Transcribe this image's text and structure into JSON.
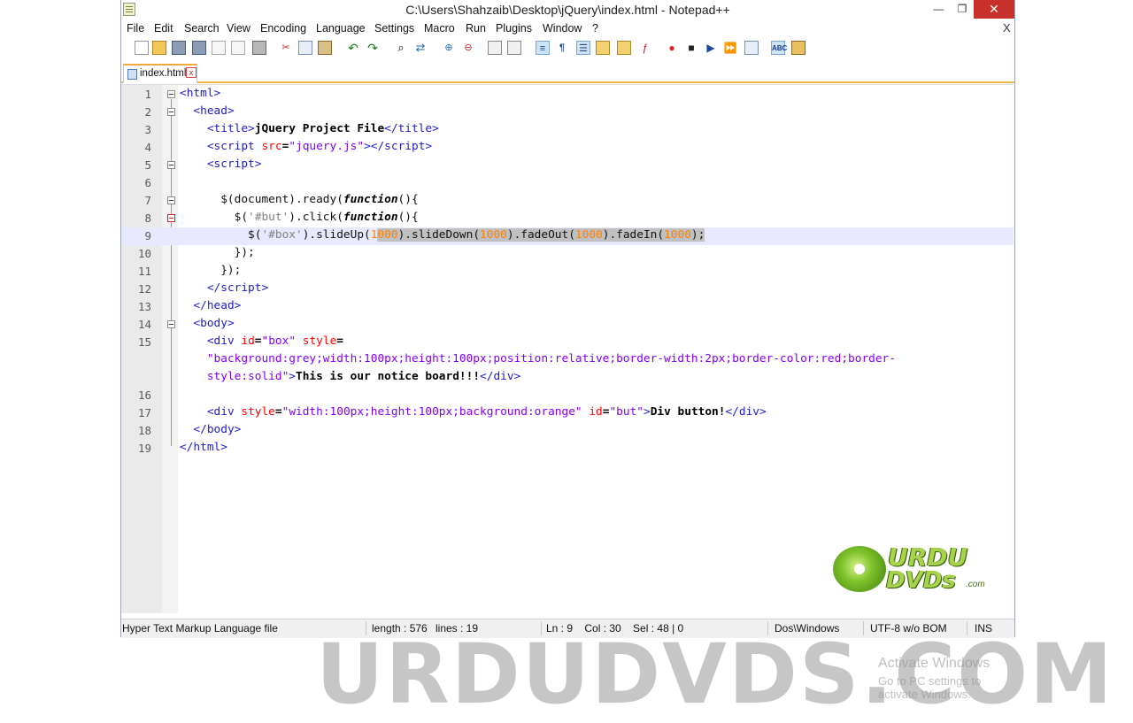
{
  "window": {
    "title": "C:\\Users\\Shahzaib\\Desktop\\jQuery\\index.html - Notepad++",
    "minimize_glyph": "—",
    "restore_glyph": "❐",
    "close_glyph": "✕"
  },
  "menu": {
    "items": [
      "File",
      "Edit",
      "Search",
      "View",
      "Encoding",
      "Language",
      "Settings",
      "Macro",
      "Run",
      "Plugins",
      "Window",
      "?"
    ],
    "close_doc": "X"
  },
  "toolbar": {
    "icons": [
      "new-file-icon",
      "open-file-icon",
      "save-icon",
      "save-all-icon",
      "close-icon",
      "close-all-icon",
      "print-icon",
      "cut-icon",
      "copy-icon",
      "paste-icon",
      "undo-icon",
      "redo-icon",
      "find-icon",
      "replace-icon",
      "zoom-in-icon",
      "zoom-out-icon",
      "sync-vertical-icon",
      "sync-horizontal-icon",
      "word-wrap-icon",
      "show-all-chars-icon",
      "indent-guide-icon",
      "udl-icon",
      "doc-map-icon",
      "function-list-icon",
      "record-macro-icon",
      "stop-record-icon",
      "play-macro-icon",
      "run-macro-multiple-icon",
      "save-macro-icon",
      "spell-check-icon",
      "plugin-icon"
    ]
  },
  "tab": {
    "label": "index.html",
    "close_glyph": "x"
  },
  "editor": {
    "line_numbers": [
      "1",
      "2",
      "3",
      "4",
      "5",
      "6",
      "7",
      "8",
      "9",
      "10",
      "11",
      "12",
      "13",
      "14",
      "15",
      "16",
      "17",
      "18",
      "19"
    ],
    "current_line": 9
  },
  "watermark": {
    "text": "URDUDVDS.COM",
    "activate_title": "Activate Windows",
    "activate_sub": "Go to PC settings to activate Windows.",
    "logo_line1": "URDU",
    "logo_line2": "DVDs",
    "logo_line3": ".com"
  },
  "status": {
    "file_type": "Hyper Text Markup Language file",
    "length": "length : 576",
    "lines": "lines : 19",
    "position": "Ln : 9    Col : 30    Sel : 48 | 0",
    "eol": "Dos\\Windows",
    "encoding": "UTF-8 w/o BOM",
    "mode": "INS"
  },
  "colors": {
    "tag": "#1c1ccc",
    "attribute": "#ff0000",
    "attr_value": "#8000ff",
    "number": "#ff8000",
    "string": "#808080",
    "current_line": "#e8e8ff",
    "close_button": "#c7302b"
  }
}
